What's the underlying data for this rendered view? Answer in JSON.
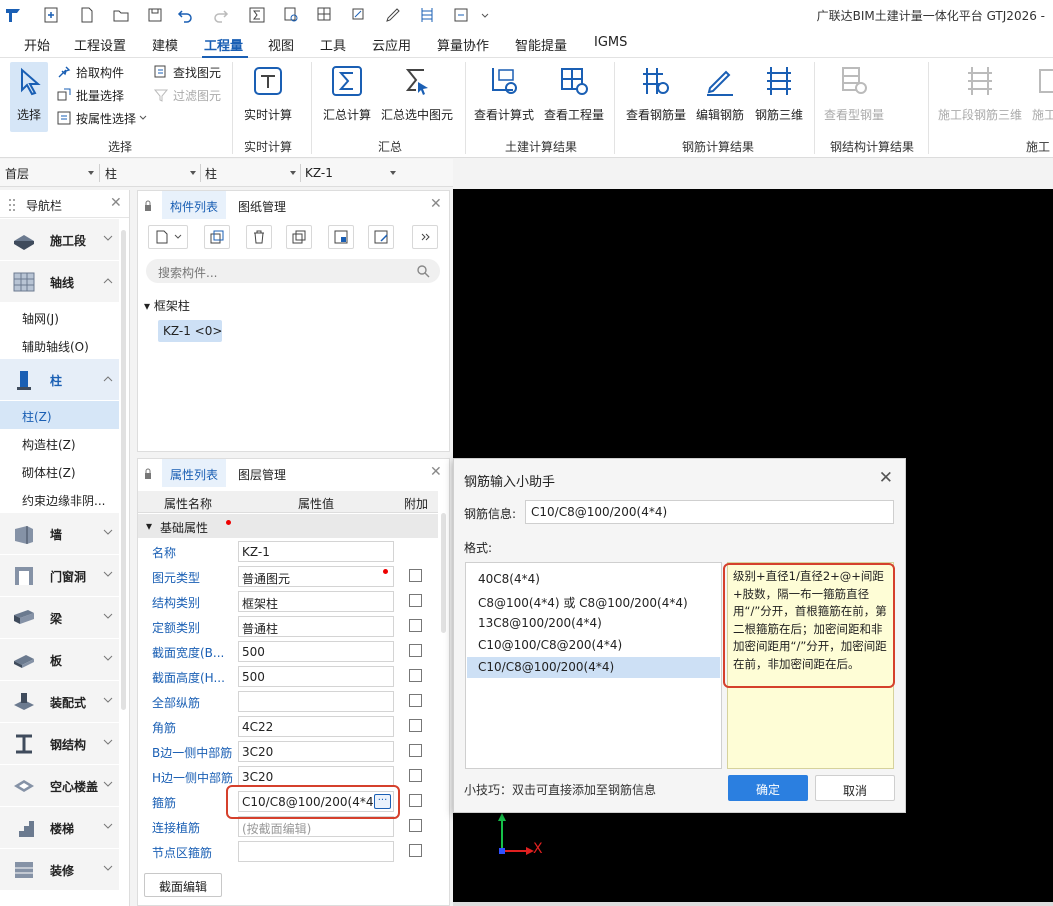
{
  "app_title": "广联达BIM土建计量一体化平台 GTJ2026 -",
  "menu": {
    "items": [
      "开始",
      "工程设置",
      "建模",
      "工程量",
      "视图",
      "工具",
      "云应用",
      "算量协作",
      "智能提量",
      "IGMS"
    ],
    "active": "工程量"
  },
  "ribbon": {
    "select_label": "选择",
    "pick_label": "拾取构件",
    "batch_label": "批量选择",
    "by_attr_label": "按属性选择",
    "find_label": "查找图元",
    "filter_label": "过滤图元",
    "group_select": "选择",
    "realtime_calc": "实时计算",
    "group_realtime": "实时计算",
    "sum_calc": "汇总计算",
    "sum_selected": "汇总选中图元",
    "group_sum": "汇总",
    "view_formula": "查看计算式",
    "view_quantity": "查看工程量",
    "group_civil": "土建计算结果",
    "view_rebar": "查看钢筋量",
    "edit_rebar": "编辑钢筋",
    "rebar_3d": "钢筋三维",
    "group_rebar": "钢筋计算结果",
    "view_steel": "查看型钢量",
    "group_steel": "钢结构计算结果",
    "stage_rebar_3d": "施工段钢筋三维",
    "cut_label": "施工",
    "group_stage": "施工"
  },
  "selectors": {
    "floor": "首层",
    "type1": "柱",
    "type2": "柱",
    "component": "KZ-1"
  },
  "nav": {
    "title": "导航栏",
    "cats": {
      "construction_stage": "施工段",
      "axis": "轴线",
      "column": "柱",
      "wall": "墙",
      "door_window": "门窗洞",
      "beam": "梁",
      "slab": "板",
      "prefab": "装配式",
      "steel": "钢结构",
      "hollow_slab": "空心楼盖",
      "stair": "楼梯",
      "decoration": "装修"
    },
    "axis_items": [
      "轴网(J)",
      "辅助轴线(O)"
    ],
    "column_items": [
      "柱(Z)",
      "构造柱(Z)",
      "砌体柱(Z)",
      "约束边缘非阴..."
    ]
  },
  "component_list": {
    "tab_active": "构件列表",
    "tab_other": "图纸管理",
    "search_placeholder": "搜索构件...",
    "tree_root": "框架柱",
    "tree_node": "KZ-1 <0>"
  },
  "properties": {
    "tab_active": "属性列表",
    "tab_other": "图层管理",
    "col_name": "属性名称",
    "col_value": "属性值",
    "col_extra": "附加",
    "section": "基础属性",
    "rows": [
      {
        "name": "名称",
        "value": "KZ-1",
        "cb": false
      },
      {
        "name": "图元类型",
        "value": "普通图元",
        "cb": true
      },
      {
        "name": "结构类别",
        "value": "框架柱",
        "cb": true
      },
      {
        "name": "定额类别",
        "value": "普通柱",
        "cb": true
      },
      {
        "name": "截面宽度(B...",
        "value": "500",
        "cb": true
      },
      {
        "name": "截面高度(H...",
        "value": "500",
        "cb": true
      },
      {
        "name": "全部纵筋",
        "value": "",
        "cb": true
      },
      {
        "name": "角筋",
        "value": "4C22",
        "cb": true
      },
      {
        "name": "B边一侧中部筋",
        "value": "3C20",
        "cb": true
      },
      {
        "name": "H边一侧中部筋",
        "value": "3C20",
        "cb": true
      },
      {
        "name": "箍筋",
        "value": "C10/C8@100/200(4*4)",
        "cb": true
      },
      {
        "name": "连接植筋",
        "value": "(按截面编辑)",
        "cb": true
      },
      {
        "name": "节点区箍筋",
        "value": "",
        "cb": true
      }
    ],
    "section_edit": "截面编辑"
  },
  "dialog": {
    "title": "钢筋输入小助手",
    "info_label": "钢筋信息:",
    "info_value": "C10/C8@100/200(4*4)",
    "format_label": "格式:",
    "formats": [
      "40C8(4*4)",
      "C8@100(4*4) 或 C8@100/200(4*4)",
      "13C8@100/200(4*4)",
      "C10@100/C8@200(4*4)",
      "C10/C8@100/200(4*4)"
    ],
    "selected_index": 4,
    "description": "级别+直径1/直径2+@+间距+肢数，隔一布一箍筋直径用“/”分开，首根箍筋在前，第二根箍筋在后；加密间距和非加密间距用“/”分开，加密间距在前，非加密间距在后。",
    "tip": "小技巧：双击可直接添加至钢筋信息",
    "ok": "确定",
    "cancel": "取消"
  },
  "canvas_axis": {
    "x": "X"
  },
  "colors": {
    "accent": "#1a5fb4",
    "highlight": "#d5402c",
    "ok_button": "#2b7fe0",
    "canvas": "#000000"
  }
}
